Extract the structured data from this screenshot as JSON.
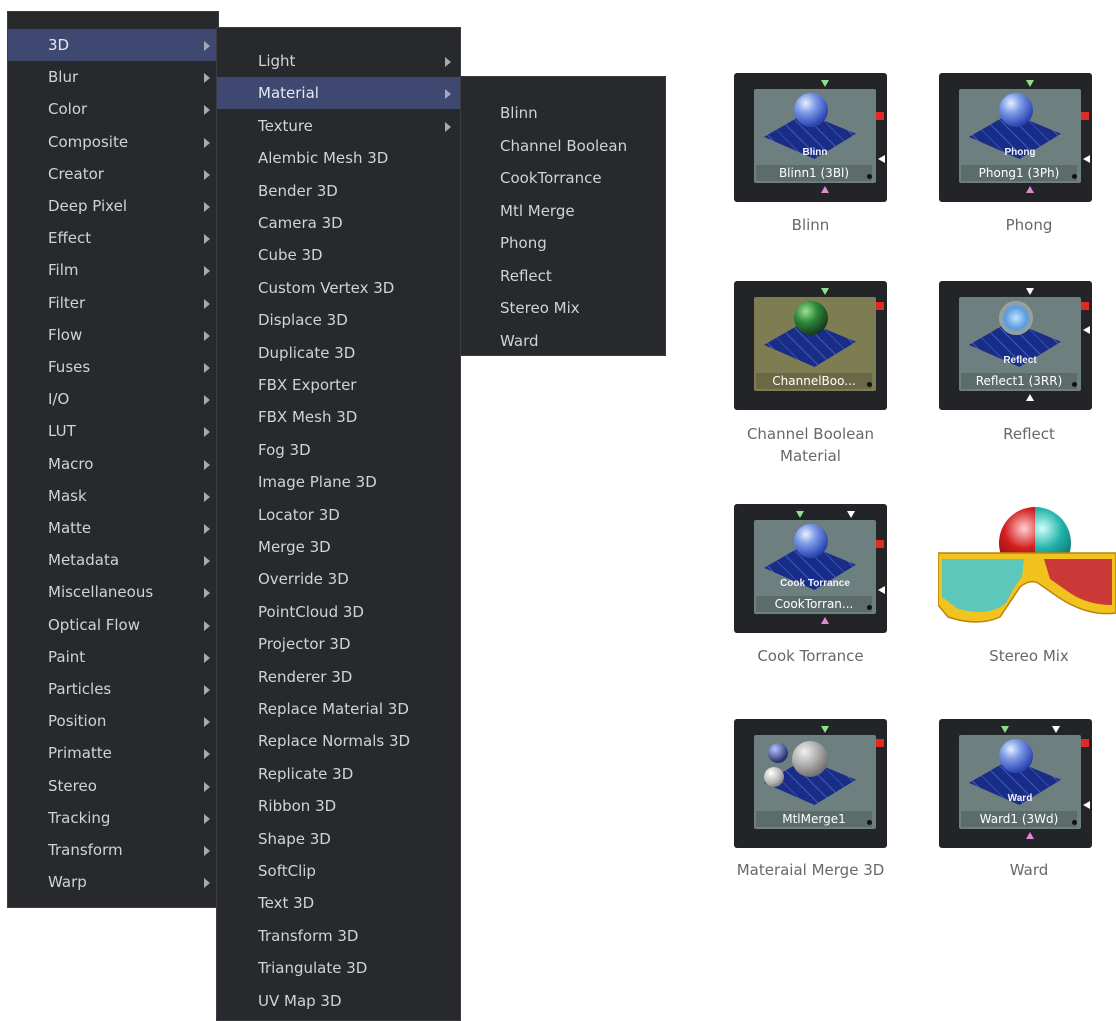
{
  "category_menu": {
    "items": [
      {
        "label": "3D",
        "submenu": true,
        "highlighted": true
      },
      {
        "label": "Blur",
        "submenu": true
      },
      {
        "label": "Color",
        "submenu": true
      },
      {
        "label": "Composite",
        "submenu": true
      },
      {
        "label": "Creator",
        "submenu": true
      },
      {
        "label": "Deep Pixel",
        "submenu": true
      },
      {
        "label": "Effect",
        "submenu": true
      },
      {
        "label": "Film",
        "submenu": true
      },
      {
        "label": "Filter",
        "submenu": true
      },
      {
        "label": "Flow",
        "submenu": true
      },
      {
        "label": "Fuses",
        "submenu": true
      },
      {
        "label": "I/O",
        "submenu": true
      },
      {
        "label": "LUT",
        "submenu": true
      },
      {
        "label": "Macro",
        "submenu": true
      },
      {
        "label": "Mask",
        "submenu": true
      },
      {
        "label": "Matte",
        "submenu": true
      },
      {
        "label": "Metadata",
        "submenu": true
      },
      {
        "label": "Miscellaneous",
        "submenu": true
      },
      {
        "label": "Optical Flow",
        "submenu": true
      },
      {
        "label": "Paint",
        "submenu": true
      },
      {
        "label": "Particles",
        "submenu": true
      },
      {
        "label": "Position",
        "submenu": true
      },
      {
        "label": "Primatte",
        "submenu": true
      },
      {
        "label": "Stereo",
        "submenu": true
      },
      {
        "label": "Tracking",
        "submenu": true
      },
      {
        "label": "Transform",
        "submenu": true
      },
      {
        "label": "Warp",
        "submenu": true
      }
    ]
  },
  "submenu_3d": {
    "items": [
      {
        "label": "Light",
        "submenu": true
      },
      {
        "label": "Material",
        "submenu": true,
        "highlighted": true
      },
      {
        "label": "Texture",
        "submenu": true
      },
      {
        "label": "Alembic Mesh 3D"
      },
      {
        "label": "Bender 3D"
      },
      {
        "label": "Camera 3D"
      },
      {
        "label": "Cube 3D"
      },
      {
        "label": "Custom Vertex 3D"
      },
      {
        "label": "Displace 3D"
      },
      {
        "label": "Duplicate 3D"
      },
      {
        "label": "FBX Exporter"
      },
      {
        "label": "FBX Mesh 3D"
      },
      {
        "label": "Fog 3D"
      },
      {
        "label": "Image Plane 3D"
      },
      {
        "label": "Locator 3D"
      },
      {
        "label": "Merge 3D"
      },
      {
        "label": "Override 3D"
      },
      {
        "label": "PointCloud 3D"
      },
      {
        "label": "Projector 3D"
      },
      {
        "label": "Renderer 3D"
      },
      {
        "label": "Replace Material 3D"
      },
      {
        "label": "Replace Normals 3D"
      },
      {
        "label": "Replicate 3D"
      },
      {
        "label": "Ribbon 3D"
      },
      {
        "label": "Shape 3D"
      },
      {
        "label": "SoftClip"
      },
      {
        "label": "Text 3D"
      },
      {
        "label": "Transform 3D"
      },
      {
        "label": "Triangulate 3D"
      },
      {
        "label": "UV Map 3D"
      }
    ]
  },
  "submenu_material": {
    "items": [
      {
        "label": "Blinn"
      },
      {
        "label": "Channel Boolean"
      },
      {
        "label": "CookTorrance"
      },
      {
        "label": "Mtl Merge"
      },
      {
        "label": "Phong"
      },
      {
        "label": "Reflect"
      },
      {
        "label": "Stereo Mix"
      },
      {
        "label": "Ward"
      }
    ]
  },
  "nodes": {
    "blinn": {
      "icon_title": "Blinn",
      "node_name": "Blinn1  (3Bl)",
      "caption": "Blinn"
    },
    "phong": {
      "icon_title": "Phong",
      "node_name": "Phong1  (3Ph)",
      "caption": "Phong"
    },
    "channel_boolean": {
      "icon_title": "",
      "node_name": "ChannelBoo...",
      "caption_line1": "Channel Boolean",
      "caption_line2": "Material"
    },
    "reflect": {
      "icon_title": "Reflect",
      "node_name": "Reflect1  (3RR)",
      "caption": "Reflect"
    },
    "cook_torrance": {
      "icon_title": "Cook Torrance",
      "node_name": "CookTorran...",
      "caption": "Cook Torrance"
    },
    "stereo_mix": {
      "caption": "Stereo Mix"
    },
    "mtl_merge": {
      "icon_title": "",
      "node_name": "MtlMerge1",
      "caption": "Materaial Merge 3D"
    },
    "ward": {
      "icon_title": "Ward",
      "node_name": "Ward1  (3Wd)",
      "caption": "Ward"
    }
  },
  "colors": {
    "menu_bg": "#28292d",
    "menu_highlight": "#3f4870",
    "node_tile": "#6d7f7e",
    "output_port": "#e02a24"
  }
}
